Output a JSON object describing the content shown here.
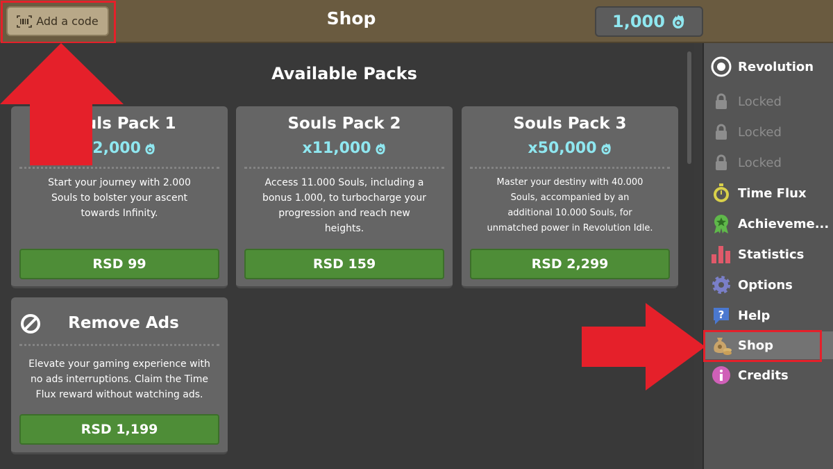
{
  "header": {
    "code_button_label": "Add a code",
    "title": "Shop",
    "currency_amount": "1,000"
  },
  "main": {
    "section_title": "Available Packs",
    "packs": [
      {
        "title": "Souls Pack 1",
        "amount": "x2,000",
        "description_lines": [
          "Start your journey with 2.000",
          "Souls to bolster your ascent",
          "towards Infinity."
        ],
        "price": "RSD 99"
      },
      {
        "title": "Souls Pack 2",
        "amount": "x11,000",
        "description_lines": [
          "Access 11.000 Souls, including a",
          "bonus 1.000, to turbocharge your",
          "progression and reach new",
          "heights."
        ],
        "price": "RSD 159"
      },
      {
        "title": "Souls Pack 3",
        "amount": "x50,000",
        "description_lines": [
          "Master your destiny with 40.000",
          "Souls, accompanied by an",
          "additional 10.000 Souls, for",
          "unmatched power in Revolution Idle."
        ],
        "price": "RSD 2,299"
      }
    ],
    "remove_ads": {
      "title": "Remove Ads",
      "description_lines": [
        "Elevate your gaming experience with",
        "no ads interruptions. Claim the Time",
        "Flux reward without watching ads."
      ],
      "price": "RSD 1,199"
    }
  },
  "sidebar": {
    "items": [
      {
        "label": "Revolution",
        "icon": "target-icon"
      },
      {
        "label": "Locked",
        "icon": "lock-icon"
      },
      {
        "label": "Locked",
        "icon": "lock-icon"
      },
      {
        "label": "Locked",
        "icon": "lock-icon"
      },
      {
        "label": "Time Flux",
        "icon": "stopwatch-icon"
      },
      {
        "label": "Achieveme...",
        "icon": "award-icon"
      },
      {
        "label": "Statistics",
        "icon": "bar-chart-icon"
      },
      {
        "label": "Options",
        "icon": "gear-icon"
      },
      {
        "label": "Help",
        "icon": "help-icon"
      },
      {
        "label": "Shop",
        "icon": "money-bag-icon"
      },
      {
        "label": "Credits",
        "icon": "info-icon"
      }
    ]
  },
  "colors": {
    "header_bg": "#6a5b40",
    "accent_cyan": "#8fe7f0",
    "buy_green": "#4e8d37",
    "highlight_red": "#e5202a"
  }
}
